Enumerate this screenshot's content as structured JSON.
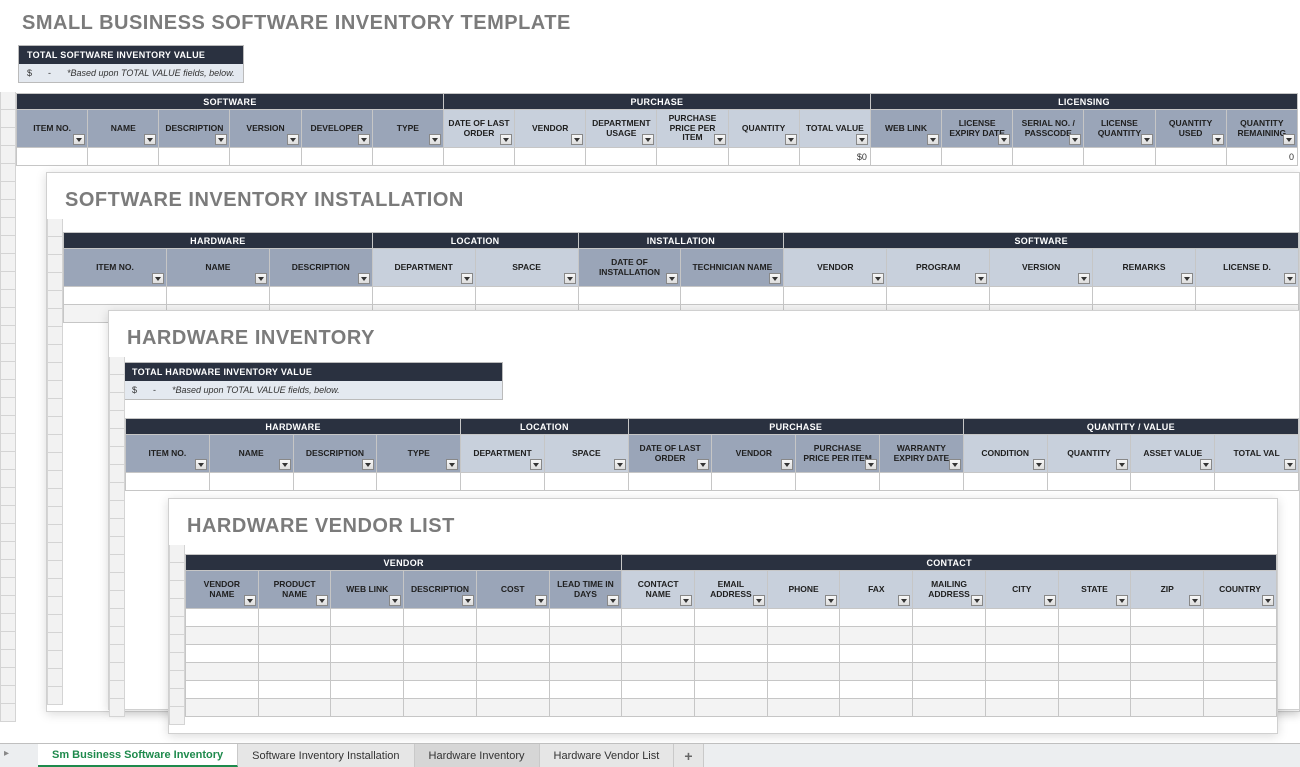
{
  "layer1": {
    "title": "SMALL BUSINESS SOFTWARE INVENTORY TEMPLATE",
    "valueBox": {
      "header": "TOTAL SOFTWARE INVENTORY VALUE",
      "currency": "$",
      "amount": "-",
      "note": "*Based upon TOTAL VALUE fields, below."
    },
    "groups": [
      {
        "label": "SOFTWARE",
        "span": 6
      },
      {
        "label": "PURCHASE",
        "span": 6,
        "light": true
      },
      {
        "label": "LICENSING",
        "span": 6
      }
    ],
    "cols": [
      {
        "label": "ITEM NO."
      },
      {
        "label": "NAME"
      },
      {
        "label": "DESCRIPTION"
      },
      {
        "label": "VERSION"
      },
      {
        "label": "DEVELOPER"
      },
      {
        "label": "TYPE"
      },
      {
        "label": "DATE OF LAST ORDER",
        "light": true
      },
      {
        "label": "VENDOR",
        "light": true
      },
      {
        "label": "DEPARTMENT USAGE",
        "light": true
      },
      {
        "label": "PURCHASE PRICE PER ITEM",
        "light": true
      },
      {
        "label": "QUANTITY",
        "light": true
      },
      {
        "label": "TOTAL VALUE",
        "light": true
      },
      {
        "label": "WEB LINK"
      },
      {
        "label": "LICENSE EXPIRY DATE"
      },
      {
        "label": "SERIAL NO. / PASSCODE"
      },
      {
        "label": "LICENSE QUANTITY"
      },
      {
        "label": "QUANTITY USED"
      },
      {
        "label": "QUANTITY REMAINING"
      }
    ],
    "row1": {
      "totalValue": "$0",
      "qtyRemaining": "0"
    }
  },
  "layer2": {
    "title": "SOFTWARE INVENTORY INSTALLATION",
    "groups": [
      {
        "label": "HARDWARE",
        "span": 3
      },
      {
        "label": "LOCATION",
        "span": 2,
        "light": true
      },
      {
        "label": "INSTALLATION",
        "span": 2
      },
      {
        "label": "SOFTWARE",
        "span": 5,
        "light": true
      }
    ],
    "cols": [
      {
        "label": "ITEM NO."
      },
      {
        "label": "NAME"
      },
      {
        "label": "DESCRIPTION"
      },
      {
        "label": "DEPARTMENT",
        "light": true
      },
      {
        "label": "SPACE",
        "light": true
      },
      {
        "label": "DATE OF INSTALLATION"
      },
      {
        "label": "TECHNICIAN NAME"
      },
      {
        "label": "VENDOR",
        "light": true
      },
      {
        "label": "PROGRAM",
        "light": true
      },
      {
        "label": "VERSION",
        "light": true
      },
      {
        "label": "REMARKS",
        "light": true
      },
      {
        "label": "LICENSE D.",
        "light": true
      }
    ]
  },
  "layer3": {
    "title": "HARDWARE INVENTORY",
    "valueBox": {
      "header": "TOTAL HARDWARE INVENTORY VALUE",
      "currency": "$",
      "amount": "-",
      "note": "*Based upon TOTAL VALUE fields, below."
    },
    "groups": [
      {
        "label": "HARDWARE",
        "span": 4
      },
      {
        "label": "LOCATION",
        "span": 2,
        "light": true
      },
      {
        "label": "PURCHASE",
        "span": 4
      },
      {
        "label": "QUANTITY / VALUE",
        "span": 4,
        "light": true
      }
    ],
    "cols": [
      {
        "label": "ITEM NO."
      },
      {
        "label": "NAME"
      },
      {
        "label": "DESCRIPTION"
      },
      {
        "label": "TYPE"
      },
      {
        "label": "DEPARTMENT",
        "light": true
      },
      {
        "label": "SPACE",
        "light": true
      },
      {
        "label": "DATE OF LAST ORDER"
      },
      {
        "label": "VENDOR"
      },
      {
        "label": "PURCHASE PRICE PER ITEM"
      },
      {
        "label": "WARRANTY EXPIRY DATE"
      },
      {
        "label": "CONDITION",
        "light": true
      },
      {
        "label": "QUANTITY",
        "light": true
      },
      {
        "label": "ASSET VALUE",
        "light": true
      },
      {
        "label": "TOTAL VAL",
        "light": true
      }
    ]
  },
  "layer4": {
    "title": "HARDWARE VENDOR LIST",
    "groups": [
      {
        "label": "VENDOR",
        "span": 6
      },
      {
        "label": "CONTACT",
        "span": 9,
        "light": true
      }
    ],
    "cols": [
      {
        "label": "VENDOR NAME"
      },
      {
        "label": "PRODUCT NAME"
      },
      {
        "label": "WEB LINK"
      },
      {
        "label": "DESCRIPTION"
      },
      {
        "label": "COST"
      },
      {
        "label": "LEAD TIME IN DAYS"
      },
      {
        "label": "CONTACT NAME",
        "light": true
      },
      {
        "label": "EMAIL ADDRESS",
        "light": true
      },
      {
        "label": "PHONE",
        "light": true
      },
      {
        "label": "FAX",
        "light": true
      },
      {
        "label": "MAILING ADDRESS",
        "light": true
      },
      {
        "label": "CITY",
        "light": true
      },
      {
        "label": "STATE",
        "light": true
      },
      {
        "label": "ZIP",
        "light": true
      },
      {
        "label": "COUNTRY",
        "light": true
      }
    ]
  },
  "tabs": [
    {
      "label": "Sm Business Software Inventory",
      "state": "active"
    },
    {
      "label": "Software Inventory Installation",
      "state": ""
    },
    {
      "label": "Hardware Inventory",
      "state": "sel"
    },
    {
      "label": "Hardware Vendor List",
      "state": ""
    }
  ],
  "tabAdd": "+"
}
